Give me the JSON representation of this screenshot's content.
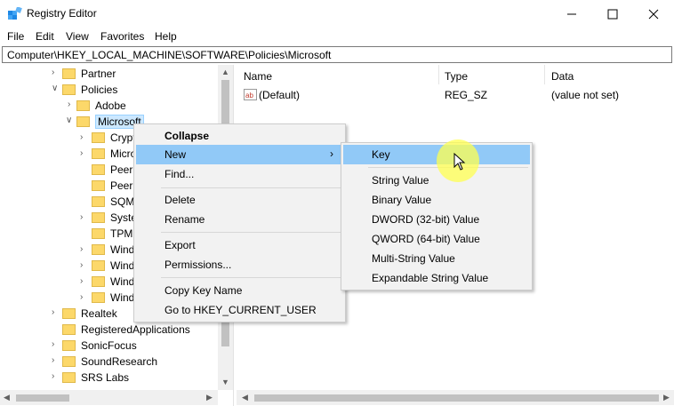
{
  "window": {
    "title": "Registry Editor"
  },
  "menu": [
    "File",
    "Edit",
    "View",
    "Favorites",
    "Help"
  ],
  "address": "Computer\\HKEY_LOCAL_MACHINE\\SOFTWARE\\Policies\\Microsoft",
  "tree": {
    "partner": "Partner",
    "policies": "Policies",
    "adobe": "Adobe",
    "microsoft": "Microsoft",
    "children": [
      "Crypt",
      "Micro",
      "PeerD",
      "Peern",
      "SQM",
      "Syste",
      "TPM",
      "Wind",
      "Wind",
      "Wind",
      "Wind"
    ],
    "realtek": "Realtek",
    "registered_apps": "RegisteredApplications",
    "sonicfocus": "SonicFocus",
    "soundresearch": "SoundResearch",
    "srs": "SRS Labs"
  },
  "list": {
    "headers": {
      "name": "Name",
      "type": "Type",
      "data": "Data"
    },
    "rows": [
      {
        "name": "(Default)",
        "type": "REG_SZ",
        "data": "(value not set)"
      }
    ]
  },
  "context_menu": {
    "collapse": "Collapse",
    "new": "New",
    "find": "Find...",
    "delete": "Delete",
    "rename": "Rename",
    "export": "Export",
    "permissions": "Permissions...",
    "copy_key": "Copy Key Name",
    "goto_hkcu": "Go to HKEY_CURRENT_USER"
  },
  "submenu": {
    "key": "Key",
    "string": "String Value",
    "binary": "Binary Value",
    "dword": "DWORD (32-bit) Value",
    "qword": "QWORD (64-bit) Value",
    "multi": "Multi-String Value",
    "expand": "Expandable String Value"
  },
  "colors": {
    "highlight": "#91c9f7",
    "selection": "#cce8ff",
    "folder": "#fcd86a",
    "cursor_glow": "#ffff50"
  }
}
